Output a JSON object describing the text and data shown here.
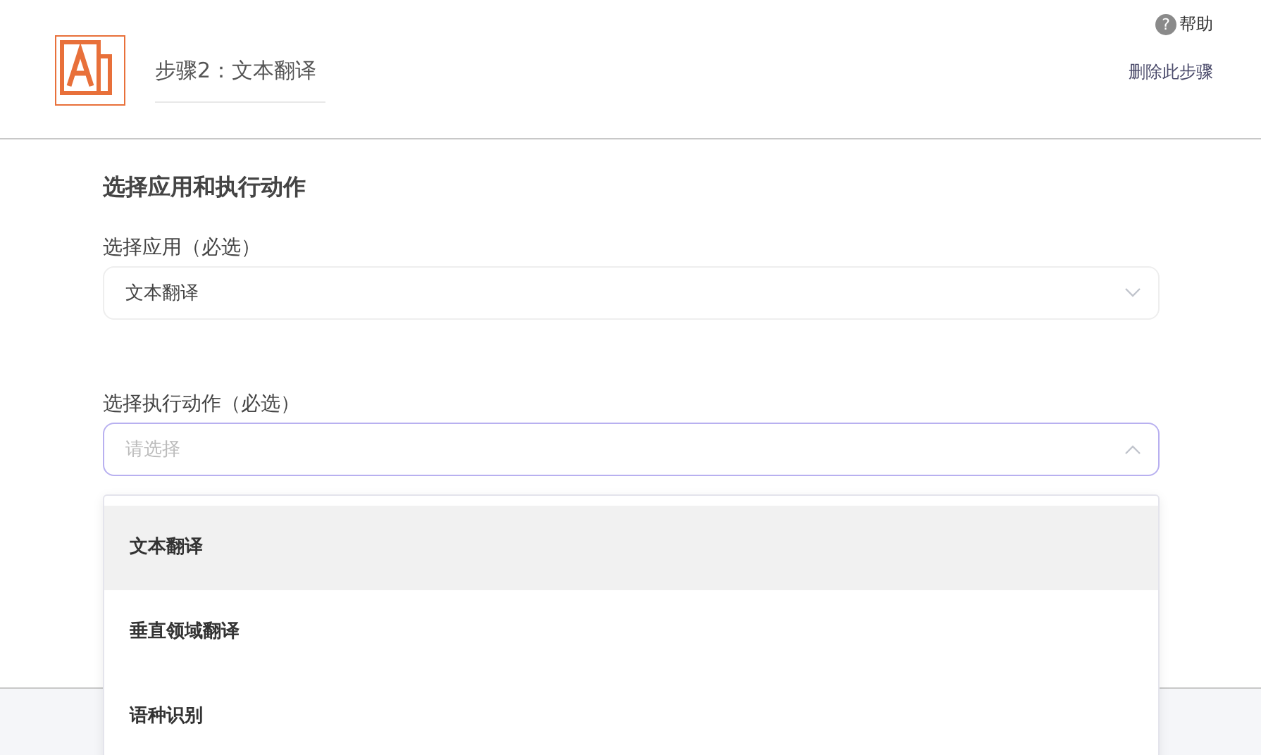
{
  "header": {
    "step_title": "步骤2：文本翻译",
    "help_icon": "?",
    "help": "帮助",
    "delete_step": "删除此步骤"
  },
  "section": {
    "title": "选择应用和执行动作",
    "app_field": {
      "label": "选择应用（必选）",
      "value": "文本翻译",
      "expanded": false
    },
    "action_field": {
      "label": "选择执行动作（必选）",
      "placeholder": "请选择",
      "expanded": true,
      "options": [
        {
          "label": "文本翻译",
          "highlighted": true
        },
        {
          "label": "垂直领域翻译",
          "highlighted": false
        },
        {
          "label": "语种识别",
          "highlighted": false
        }
      ]
    }
  }
}
